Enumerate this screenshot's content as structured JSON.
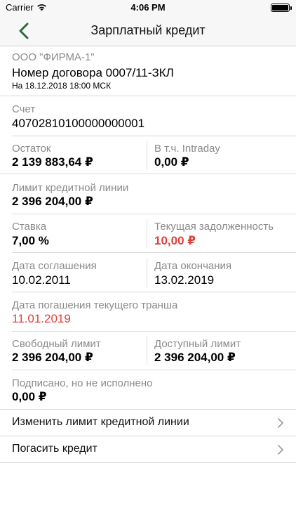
{
  "status": {
    "carrier": "Carrier",
    "time": "4:06 PM"
  },
  "nav": {
    "title": "Зарплатный кредит"
  },
  "header": {
    "company": "ООО \"ФИРМА-1\"",
    "contract": "Номер договора 0007/11-ЗКЛ",
    "date": "На 18.12.2018 18:00 МСК"
  },
  "account": {
    "label": "Счет",
    "value": "40702810100000000001"
  },
  "balance": {
    "label": "Остаток",
    "value": "2 139 883,64 ₽"
  },
  "intraday": {
    "label": "В т.ч. Intraday",
    "value": "0,00 ₽"
  },
  "credit_limit": {
    "label": "Лимит кредитной линии",
    "value": "2 396 204,00 ₽"
  },
  "rate": {
    "label": "Ставка",
    "value": "7,00 %"
  },
  "current_debt": {
    "label": "Текущая задолженность",
    "value": "10,00 ₽"
  },
  "agreement_date": {
    "label": "Дата соглашения",
    "value": "10.02.2011"
  },
  "end_date": {
    "label": "Дата окончания",
    "value": "13.02.2019"
  },
  "tranche_date": {
    "label": "Дата погашения текущего транша",
    "value": "11.01.2019"
  },
  "free_limit": {
    "label": "Свободный лимит",
    "value": "2 396 204,00 ₽"
  },
  "available_limit": {
    "label": "Доступный лимит",
    "value": "2 396 204,00 ₽"
  },
  "signed_pending": {
    "label": "Подписано, но не исполнено",
    "value": "0,00 ₽"
  },
  "actions": {
    "change_limit": "Изменить лимит кредитной линии",
    "repay": "Погасить кредит"
  },
  "colors": {
    "accent": "#2e6b3a",
    "danger": "#e0403a",
    "secondary_text": "#8a8a8a"
  }
}
